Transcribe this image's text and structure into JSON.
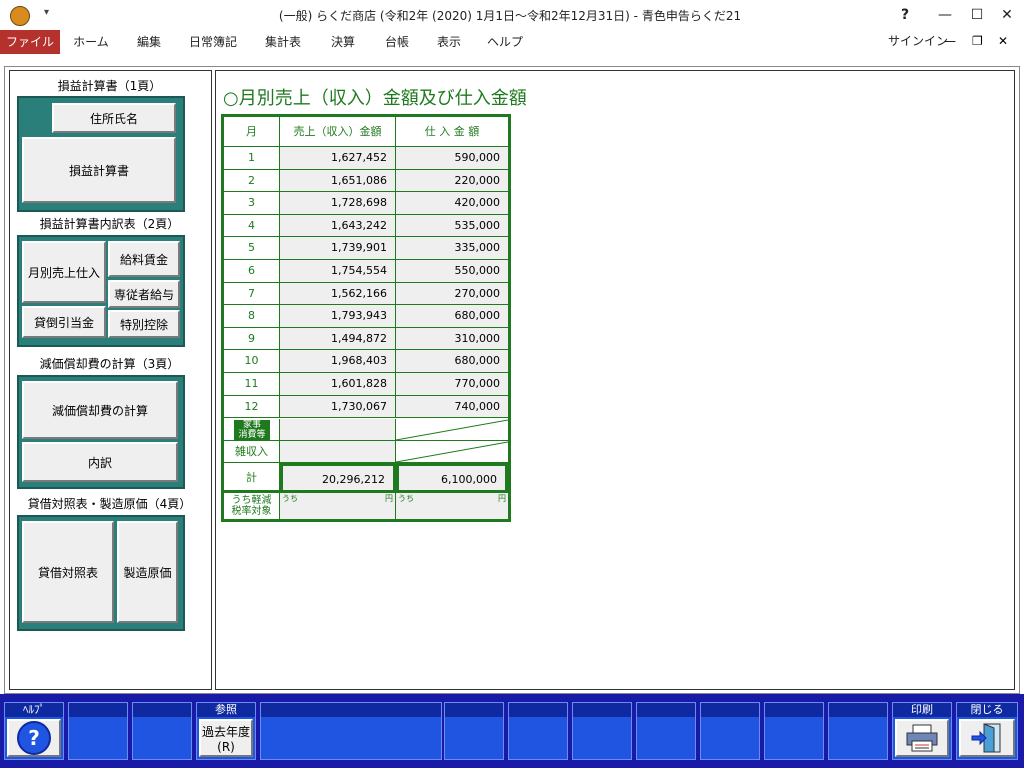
{
  "window": {
    "title": "(一般) らくだ商店 (令和2年 (2020) 1月1日〜令和2年12月31日) - 青色申告らくだ21",
    "help_glyph": "?",
    "minimize_glyph": "—",
    "maximize_glyph": "☐",
    "close_glyph": "✕",
    "signin_label": "サインイン",
    "restore_glyph": "❐"
  },
  "menu": {
    "items": [
      "ファイル",
      "ホーム",
      "編集",
      "日常簿記",
      "集計表",
      "決算",
      "台帳",
      "表示",
      "ヘルプ"
    ]
  },
  "sidebar": {
    "section1": "損益計算書（1頁）",
    "btn_address": "住所氏名",
    "btn_pl": "損益計算書",
    "section2": "損益計算書内訳表（2頁）",
    "btn_monthly": "月別売上仕入",
    "btn_salary": "給料賃金",
    "btn_family_salary": "専従者給与",
    "btn_bad_debt": "貸倒引当金",
    "btn_special": "特別控除",
    "section3": "減価償却費の計算（3頁）",
    "btn_depreciation": "減価償却費の計算",
    "btn_breakdown": "内訳",
    "section4": "貸借対照表・製造原価（4頁）",
    "btn_balance": "貸借対照表",
    "btn_mfg": "製造原価"
  },
  "main": {
    "heading": "○月別売上（収入）金額及び仕入金額",
    "col_month": "月",
    "col_sales": "売上（収入）金額",
    "col_purchase": "仕 入 金 額",
    "yen_mark": "円",
    "rows": [
      {
        "month": "1",
        "sales": "1,627,452",
        "purchase": "590,000"
      },
      {
        "month": "2",
        "sales": "1,651,086",
        "purchase": "220,000"
      },
      {
        "month": "3",
        "sales": "1,728,698",
        "purchase": "420,000"
      },
      {
        "month": "4",
        "sales": "1,643,242",
        "purchase": "535,000"
      },
      {
        "month": "5",
        "sales": "1,739,901",
        "purchase": "335,000"
      },
      {
        "month": "6",
        "sales": "1,754,554",
        "purchase": "550,000"
      },
      {
        "month": "7",
        "sales": "1,562,166",
        "purchase": "270,000"
      },
      {
        "month": "8",
        "sales": "1,793,943",
        "purchase": "680,000"
      },
      {
        "month": "9",
        "sales": "1,494,872",
        "purchase": "310,000"
      },
      {
        "month": "10",
        "sales": "1,968,403",
        "purchase": "680,000"
      },
      {
        "month": "11",
        "sales": "1,601,828",
        "purchase": "770,000"
      },
      {
        "month": "12",
        "sales": "1,730,067",
        "purchase": "740,000"
      }
    ],
    "household_label_1": "家事",
    "household_label_2": "消費等",
    "misc_income_label": "雑収入",
    "total_label": "計",
    "total_sales": "20,296,212",
    "total_purchase": "6,100,000",
    "reduced_label_1": "うち軽減",
    "reduced_label_2": "税率対象",
    "uchi_label": "うち"
  },
  "toolbar": {
    "help_head": "ﾍﾙﾌﾟ",
    "help_glyph": "?",
    "ref_head": "参照",
    "past_year_label": "過去年度",
    "past_year_key": "(R)",
    "print_head": "印刷",
    "close_head": "閉じる"
  },
  "colors": {
    "accent_green": "#1f7a1f",
    "teal_frame": "#2a7f7a",
    "toolbar_blue": "#1a1aa8",
    "menu_file_red": "#b5312b"
  }
}
